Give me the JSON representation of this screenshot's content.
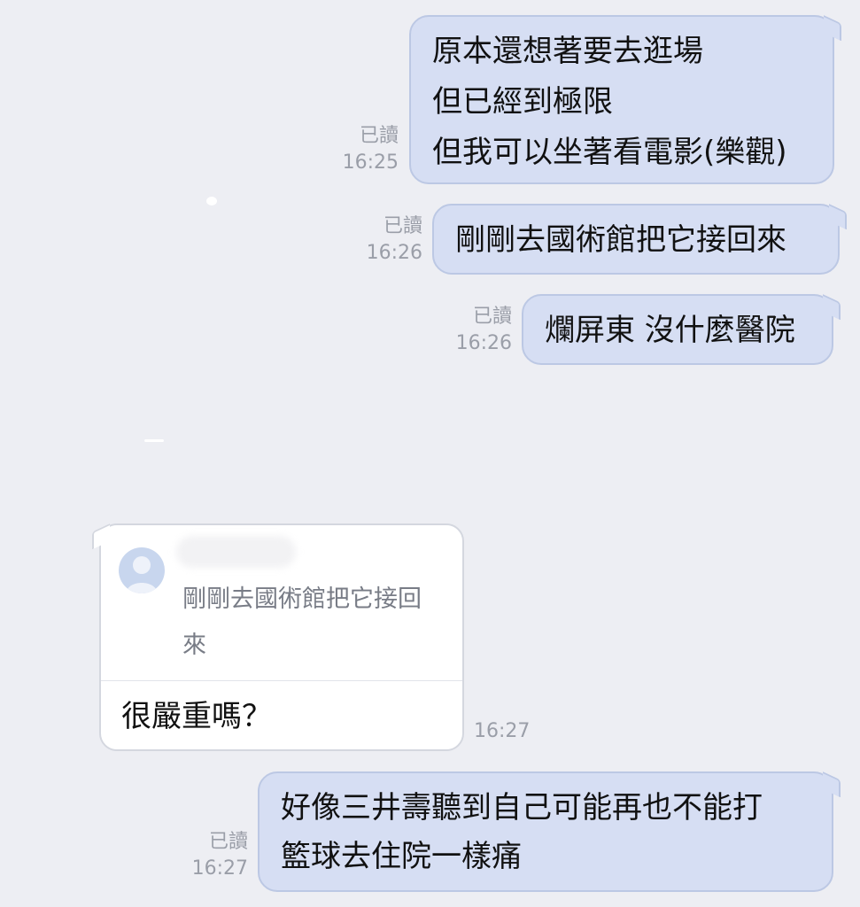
{
  "messages": [
    {
      "text": "原本還想著要去逛場\n但已經到極限\n但我可以坐著看電影(樂觀)",
      "read": "已讀",
      "time": "16:25"
    },
    {
      "text": "剛剛去國術館把它接回來",
      "read": "已讀",
      "time": "16:26"
    },
    {
      "text": "爛屏東 沒什麼醫院",
      "read": "已讀",
      "time": "16:26"
    }
  ],
  "reply": {
    "quoted_text": "剛剛去國術館把它接回\n來",
    "text": "很嚴重嗎？",
    "time": "16:27"
  },
  "last_message": {
    "text": "好像三井壽聽到自己可能再也不能打\n籃球去住院一樣痛",
    "read": "已讀",
    "time": "16:27"
  },
  "colors": {
    "background": "#edeef3",
    "sent_bubble": "#d6def3",
    "received_bubble": "#ffffff"
  }
}
